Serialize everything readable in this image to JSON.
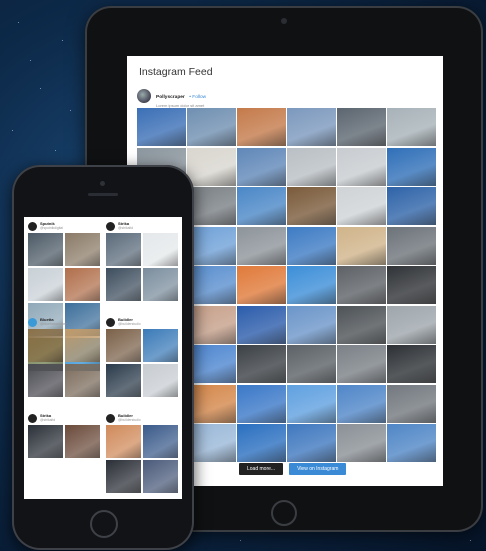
{
  "tablet": {
    "title": "Instagram Feed",
    "profile": {
      "name": "Pollyscraper",
      "follow": "• Follow",
      "bio": "Lorem ipsum dolor sit amet"
    },
    "buttons": {
      "load_more": "Load more...",
      "view_on_instagram": "View on Instagram"
    },
    "grid_colors": [
      "#3b6fb6",
      "#6f8fb1",
      "#c47a4a",
      "#7b98bd",
      "#5c6670",
      "#a7b2b8",
      "#8b969e",
      "#d9d6cf",
      "#5f87b8",
      "#b9bfc4",
      "#c8ccd0",
      "#2f6fb8",
      "#3a3f44",
      "#7a8085",
      "#4a87c7",
      "#7a5a3a",
      "#cfd3d6",
      "#2e63a8",
      "#4f5559",
      "#6fa1d8",
      "#8d949a",
      "#3d7bc4",
      "#d0b48a",
      "#6c7379",
      "#2d5f2a",
      "#5a8fcf",
      "#e07a3a",
      "#3c8ed8",
      "#5d6166",
      "#2f3236",
      "#9aa2a8",
      "#c6a08a",
      "#2b5cab",
      "#6b95c9",
      "#4d5256",
      "#9ea6ac",
      "#5a6b55",
      "#4d86d0",
      "#3b4045",
      "#5b6166",
      "#7a8086",
      "#2c3034",
      "#c08060",
      "#d4874a",
      "#3a78c8",
      "#5fa0e0",
      "#4f86c8",
      "#72787e",
      "#4a7f3a",
      "#9ab8d8",
      "#2a6fc0",
      "#3f78bf",
      "#8a9096",
      "#4f86c6"
    ]
  },
  "phone": {
    "feeds": [
      {
        "name": "Sputnik",
        "sub": "@sputnikdigital",
        "cells": [
          "#4c5a66",
          "#8a7a66",
          "#c8d0d6",
          "#b06e4a",
          "#8fa8b8",
          "#3c6e9a",
          "#6b7a4a",
          "#2a8fd8"
        ]
      },
      {
        "name": "Strika",
        "sub": "@strikaltd",
        "cells": [
          "#5a6a7a",
          "#e4e8ea",
          "#3d4d5d",
          "#7a8d9d"
        ]
      },
      {
        "name": "Bluetta",
        "sub": "@bluettatweather",
        "cells": [
          "#8a7048",
          "#c09a6a",
          "#4a4a52",
          "#7a6a5a"
        ]
      },
      {
        "name": "Buildler",
        "sub": "@builderstudio",
        "cells": [
          "#7a6048",
          "#3a7ab8",
          "#2a3a4a",
          "#c7ccd1"
        ]
      },
      {
        "name": "Strika",
        "sub": "@strikaltd",
        "cells": [
          "#2a3038",
          "#6a4a3a"
        ]
      },
      {
        "name": "Buildler",
        "sub": "@builderstudio",
        "cells": [
          "#d08a5a",
          "#3a5a8a",
          "#2a2e36",
          "#4a5a7a"
        ]
      }
    ]
  }
}
